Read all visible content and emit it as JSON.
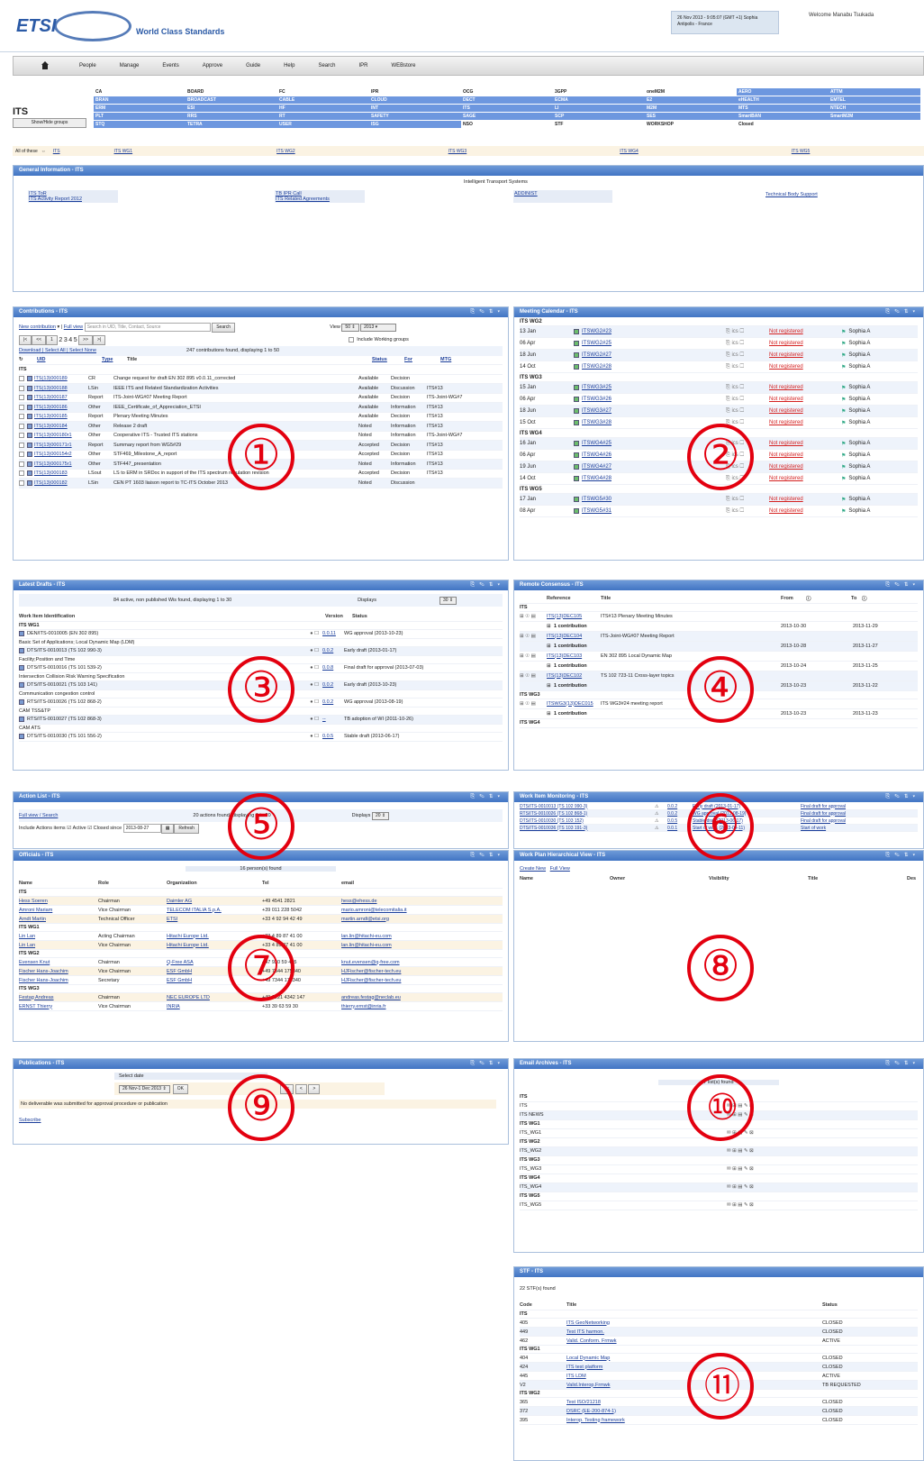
{
  "header": {
    "logo_text": "ETSI",
    "tagline": "World Class Standards",
    "user_info": "26 Nov 2013 - 9:05:07 (GMT +1) Sophia Antipolis - France",
    "welcome": "Welcome Manabu Tsukada"
  },
  "nav": [
    "People",
    "Manage",
    "Events",
    "Approve",
    "Guide",
    "Help",
    "Search",
    "IPR",
    "WEBstore"
  ],
  "groups": {
    "title": "ITS",
    "show_hide": "Show/Hide groups",
    "cells": [
      [
        "CA",
        "BOARD",
        "FC",
        "IPR",
        "OCG",
        "3GPP",
        "oneM2M",
        "AERO",
        "ATTM"
      ],
      [
        "BRAN",
        "BROADCAST",
        "CABLE",
        "CLOUD",
        "DECT",
        "ECMA",
        "E2",
        "eHEALTH",
        "EMTEL"
      ],
      [
        "ERM",
        "ESI",
        "HF",
        "INT",
        "ITS",
        "LI",
        "M2M",
        "MTS",
        "NTECH"
      ],
      [
        "PLT",
        "RRS",
        "RT",
        "SAFETY",
        "SAGE",
        "SCP",
        "SES",
        "SmartBAN",
        "SmartM2M"
      ],
      [
        "STQ",
        "TETRA",
        "USER",
        "ISG",
        "NSO",
        "STF",
        "WORKSHOP",
        "Closed",
        ""
      ]
    ],
    "highlighted": [
      [
        0,
        7
      ],
      [
        0,
        8
      ],
      [
        1,
        0
      ],
      [
        1,
        1
      ],
      [
        1,
        2
      ],
      [
        1,
        3
      ],
      [
        1,
        4
      ],
      [
        1,
        5
      ],
      [
        1,
        6
      ],
      [
        1,
        7
      ],
      [
        1,
        8
      ],
      [
        2,
        0
      ],
      [
        2,
        1
      ],
      [
        2,
        2
      ],
      [
        2,
        3
      ],
      [
        2,
        4
      ],
      [
        2,
        5
      ],
      [
        2,
        6
      ],
      [
        2,
        7
      ],
      [
        2,
        8
      ],
      [
        3,
        0
      ],
      [
        3,
        1
      ],
      [
        3,
        2
      ],
      [
        3,
        3
      ],
      [
        3,
        4
      ],
      [
        3,
        5
      ],
      [
        3,
        6
      ],
      [
        3,
        7
      ],
      [
        3,
        8
      ],
      [
        4,
        0
      ],
      [
        4,
        1
      ],
      [
        4,
        2
      ],
      [
        4,
        3
      ]
    ],
    "all_of_these": "All of these",
    "wg_links": [
      "ITS",
      "ITS WG1",
      "ITS WG2",
      "ITS WG3",
      "ITS WG4",
      "ITS WG5"
    ]
  },
  "general_info": {
    "title": "General Information - ITS",
    "center_label": "Intelligent Transport Systems",
    "links": [
      "ITS ToR",
      "ITS Activity Report 2012",
      "TB IPR Call",
      "ITS Related Agreements",
      "ADDINIST",
      "Technical Body Support"
    ]
  },
  "contributions": {
    "title": "Contributions - ITS",
    "new_link": "New contribution",
    "full_view": "Full view",
    "search_placeholder": "Search in UID, Title, Contact, Source",
    "search_btn": "Search",
    "view_label": "View",
    "view_count": "50",
    "view_year": "2013",
    "pages": [
      "1",
      "2",
      "3",
      "4",
      "5"
    ],
    "include_wg": "Include Working groups",
    "download_links": "Download | Select All | Select None",
    "found": "247 contributions found, displaying 1 to 50",
    "col_uid": "UID",
    "col_type": "Type",
    "col_title": "Title",
    "col_status": "Status",
    "col_for": "For",
    "col_mtg": "MTG",
    "group": "ITS",
    "rows": [
      [
        "ITS(13)000189",
        "CR",
        "Change request for draft EN 302 895 v0.0.11_corrected",
        "Available",
        "Decision",
        ""
      ],
      [
        "ITS(13)000188",
        "LSin",
        "IEEE ITS and Related Standardization Activities",
        "Available",
        "Discussion",
        "ITS#13"
      ],
      [
        "ITS(13)000187",
        "Report",
        "ITS-Joint-WG#07 Meeting Report",
        "Available",
        "Decision",
        "ITS-Joint-WG#7"
      ],
      [
        "ITS(13)000186",
        "Other",
        "IEEE_Certificate_of_Appreciation_ETSI",
        "Available",
        "Information",
        "ITS#13"
      ],
      [
        "ITS(13)000185",
        "Report",
        "Plenary Meeting Minutes",
        "Available",
        "Decision",
        "ITS#13"
      ],
      [
        "ITS(13)000184",
        "Other",
        "Release 2 draft",
        "Noted",
        "Information",
        "ITS#13"
      ],
      [
        "ITS(13)000180r1",
        "Other",
        "Cooperative ITS - Trusted ITS stations",
        "Noted",
        "Information",
        "ITS-Joint-WG#7"
      ],
      [
        "ITS(13)000171r1",
        "Report",
        "Summary report from WG5#29",
        "Accepted",
        "Decision",
        "ITS#13"
      ],
      [
        "ITS(13)000154r2",
        "Other",
        "STF469_Milestone_A_report",
        "Accepted",
        "Decision",
        "ITS#13"
      ],
      [
        "ITS(13)000175r1",
        "Other",
        "STF447_presentation",
        "Noted",
        "Information",
        "ITS#13"
      ],
      [
        "ITS(13)000183",
        "LSout",
        "LS to ERM in SRDoc in support of the ITS spectrum regulation revision",
        "Accepted",
        "Decision",
        "ITS#13"
      ],
      [
        "ITS(13)000182",
        "LSin",
        "CEN PT 1603 liaison report to TC-ITS October 2013",
        "Noted",
        "Discussion",
        ""
      ]
    ]
  },
  "meeting_calendar": {
    "title": "Meeting Calendar - ITS",
    "groups": [
      {
        "name": "ITS WG2",
        "rows": [
          [
            "13 Jan",
            "ITSWG2#23"
          ],
          [
            "06 Apr",
            "ITSWG2#25"
          ],
          [
            "18 Jun",
            "ITSWG2#27"
          ],
          [
            "14 Oct",
            "ITSWG2#28"
          ]
        ]
      },
      {
        "name": "ITS WG3",
        "rows": [
          [
            "15 Jan",
            "ITSWG3#25"
          ],
          [
            "06 Apr",
            "ITSWG3#26"
          ],
          [
            "18 Jun",
            "ITSWG3#27"
          ],
          [
            "15 Oct",
            "ITSWG3#28"
          ]
        ]
      },
      {
        "name": "ITS WG4",
        "rows": [
          [
            "16 Jan",
            "ITSWG4#25"
          ],
          [
            "06 Apr",
            "ITSWG4#26"
          ],
          [
            "19 Jun",
            "ITSWG4#27"
          ],
          [
            "14 Oct",
            "ITSWG4#28"
          ]
        ]
      },
      {
        "name": "ITS WG5",
        "rows": [
          [
            "17 Jan",
            "ITSWG5#30"
          ],
          [
            "08 Apr",
            "ITSWG5#31"
          ]
        ]
      }
    ],
    "reg_status": "Not registered",
    "location": "Sophia A"
  },
  "latest_drafts": {
    "title": "Latest Drafts - ITS",
    "found": "84 active, non published Wis found, displaying 1 to 30",
    "displays": "Displays",
    "count": "30",
    "col_wi": "Work Item Identification",
    "col_version": "Version",
    "col_status": "Status",
    "rows": [
      {
        "group": "ITS WG1",
        "id": "DEN/ITS-0010005 (EN 302 895)",
        "desc": "Basic Set of Applications; Local Dynamic Map (LDM)",
        "ver": "0.0.11",
        "status": "WG approval (2013-10-23)"
      },
      {
        "id": "DTS/ITS-0010013 (TS 102 990-3)",
        "desc": "Facility;Position and Time",
        "ver": "0.0.2",
        "status": "Early draft (2013-01-17)"
      },
      {
        "id": "DTS/ITS-0010016 (TS 101 539-2)",
        "desc": "Intersection Collision Risk Warning Specification",
        "ver": "0.0.8",
        "status": "Final draft for approval (2013-07-03)"
      },
      {
        "id": "DTS/ITS-0010021 (TS 103 141)",
        "desc": "Communication congestion control",
        "ver": "0.0.2",
        "status": "Early draft (2013-10-23)"
      },
      {
        "id": "RTS/ITS-0010026 (TS 102 868-2)",
        "desc": "CAM TSS&TP",
        "ver": "0.0.2",
        "status": "WG approval (2013-08-19)"
      },
      {
        "id": "RTS/ITS-0010027 (TS 102 868-3)",
        "desc": "CAM ATS",
        "ver": "--",
        "status": "TB adoption of WI (2011-10-26)"
      },
      {
        "id": "DTS/ITS-0010030 (TS 101 556-2)",
        "desc": "",
        "ver": "0.0.5",
        "status": "Stable draft (2013-06-17)"
      }
    ]
  },
  "remote_consensus": {
    "title": "Remote Consensus - ITS",
    "col_ref": "Reference",
    "col_title": "Title",
    "col_from": "From",
    "col_to": "To",
    "contribution": "1 contribution",
    "rows": [
      {
        "group": "ITS",
        "ref": "ITS(13)DEC105",
        "title": "ITS#13 Plenary Meeting Minutes",
        "from": "2013-10-30",
        "to": "2013-11-29"
      },
      {
        "ref": "ITS(13)DEC104",
        "title": "ITS-Joint-WG#07 Meeting Report",
        "from": "2013-10-28",
        "to": "2013-11-27"
      },
      {
        "ref": "ITS(13)DEC103",
        "title": "EN 302 895 Local Dynamic Map",
        "from": "2013-10-24",
        "to": "2013-11-25"
      },
      {
        "ref": "ITS(13)DEC102",
        "title": "TS 102 723-11 Cross-layer topics",
        "from": "2013-10-23",
        "to": "2013-11-22"
      },
      {
        "group": "ITS WG3",
        "ref": "ITSWG3(13)DEC015",
        "title": "ITS WG3#24 meeting report",
        "from": "2013-10-23",
        "to": "2013-11-23"
      }
    ],
    "last_group": "ITS WG4"
  },
  "action_list": {
    "title": "Action List - ITS",
    "full_view": "Full view / Search",
    "found": "20 actions found, displaying 1 to 20",
    "displays": "Displays",
    "count": "20",
    "include": "Include Actions items",
    "active": "Active",
    "closed": "Closed since",
    "date": "2013-08-27",
    "refresh": "Refresh"
  },
  "work_item_monitoring": {
    "title": "Work Item Monitoring - ITS",
    "rows": [
      [
        "DTS/ITS-0010013 (TS 102 990-3)",
        "0.0.2",
        "Early draft (2013-01-17)",
        "Final draft for approval"
      ],
      [
        "RTS/ITS-0010026 (TS 102 868-1)",
        "0.0.2",
        "WG approval (2013-08-19)",
        "Final draft for approval"
      ],
      [
        "DTS/ITS-0010030 (TS 103 152)",
        "0.0.5",
        "Stable draft (2013-06-17)",
        "Final draft for approval"
      ],
      [
        "DTS/ITS-0010036 (TS 103 191-3)",
        "0.0.1",
        "Start of work (2013-04-11)",
        "Start of work"
      ]
    ]
  },
  "officials": {
    "title": "Officials - ITS",
    "found": "16 person(s) found",
    "cols": [
      "Name",
      "Role",
      "Organization",
      "Tel",
      "email"
    ],
    "groups": [
      {
        "name": "ITS",
        "rows": [
          [
            "Hess Soeren",
            "Chairman",
            "Daimler AG",
            "+49 4541 2821",
            "hess@ehess.de"
          ],
          [
            "Amroni Mariam",
            "Vice Chairman",
            "TELECOM ITALIA S.p.A.",
            "+39 011 228 5042",
            "mario.amroni@telecomitalia.it"
          ],
          [
            "Arndt Martin",
            "Technical Officer",
            "ETSI",
            "+33 4 92 94 42 49",
            "martin.arndt@etsi.org"
          ]
        ]
      },
      {
        "name": "ITS WG1",
        "rows": [
          [
            "Lin Lan",
            "Acting Chairman",
            "Hitachi Europe Ltd.",
            "+33 4 89 87 41 00",
            "lan.lin@hitachi-eu.com"
          ],
          [
            "Lin Lan",
            "Vice Chairman",
            "Hitachi Europe Ltd.",
            "+33 4 89 87 41 00",
            "lan.lin@hitachi-eu.com"
          ]
        ]
      },
      {
        "name": "ITS WG2",
        "rows": [
          [
            "Evensen Knut",
            "Chairman",
            "Q-Free ASA",
            "+47 920 59 405",
            "knut.evensen@q-free.com"
          ],
          [
            "Fischer Hans-Joachim",
            "Vice Chairman",
            "ESF GmbH",
            "+49 7344 175340",
            "HJFischer@fischer-tech.eu"
          ],
          [
            "Fischer Hans-Joachim",
            "Secretary",
            "ESF GmbH",
            "+49 7344 175340",
            "HJFischer@fischer-tech.eu"
          ]
        ]
      },
      {
        "name": "ITS WG3",
        "rows": [
          [
            "Festag Andreas",
            "Chairman",
            "NEC EUROPE LTD",
            "+49 6221 4342 147",
            "andreas.festag@neclab.eu"
          ],
          [
            "ERNST Thierry",
            "Vice Chairman",
            "INRIA",
            "+33 39 63 59 30",
            "thierry.ernst@inria.fr"
          ]
        ]
      }
    ]
  },
  "work_plan": {
    "title": "Work Plan Hierarchical View - ITS",
    "create_new": "Create New",
    "full_view": "Full View",
    "cols": [
      "Name",
      "Owner",
      "Visibility",
      "Title",
      "Des"
    ]
  },
  "publications": {
    "title": "Publications - ITS",
    "select_date": "Select date",
    "date_value": "26 Nov-1 Dec 2013",
    "ok": "OK",
    "nav": [
      "<<",
      "<",
      ">"
    ],
    "message": "No deliverable was submitted for approval procedure or publication",
    "subscribe": "Subscribe"
  },
  "email_archives": {
    "title": "Email Archives - ITS",
    "found": "7 list(s) found",
    "rows": [
      {
        "group": "ITS",
        "name": "ITS"
      },
      {
        "name": "ITS NEWS"
      },
      {
        "group": "ITS WG1",
        "name": "ITS_WG1"
      },
      {
        "group": "ITS WG2",
        "name": "ITS_WG2"
      },
      {
        "group": "ITS WG3",
        "name": "ITS_WG3"
      },
      {
        "group": "ITS WG4",
        "name": "ITS_WG4"
      },
      {
        "group": "ITS WG5",
        "name": "ITS_WG5"
      }
    ]
  },
  "stf": {
    "title": "STF - ITS",
    "found": "22 STF(s) found",
    "cols": [
      "Code",
      "Title",
      "Status"
    ],
    "groups": [
      {
        "name": "ITS",
        "rows": [
          [
            "405",
            "ITS GeoNetworking",
            "CLOSED"
          ],
          [
            "449",
            "Test ITS harmon.",
            "CLOSED"
          ],
          [
            "462",
            "Valid. Conform. Frmwk",
            "ACTIVE"
          ]
        ]
      },
      {
        "name": "ITS WG1",
        "rows": [
          [
            "404",
            "Local Dynamic Map",
            "CLOSED"
          ],
          [
            "424",
            "ITS test platform",
            "CLOSED"
          ],
          [
            "445",
            "ITS LDM",
            "ACTIVE"
          ],
          [
            "V2",
            "Valid.Interop.Frmwk",
            "TB REQUESTED"
          ]
        ]
      },
      {
        "name": "ITS WG2",
        "rows": [
          [
            "365",
            "Test ISO/21218",
            "CLOSED"
          ],
          [
            "372",
            "DSRC (EE-200-874-1)",
            "CLOSED"
          ],
          [
            "395",
            "Interop. Testing framework",
            "CLOSED"
          ]
        ]
      }
    ]
  },
  "markers": [
    "①",
    "②",
    "③",
    "④",
    "⑤",
    "⑥",
    "⑦",
    "⑧",
    "⑨",
    "⑩",
    "⑪"
  ],
  "colors": {
    "panel_header": "#4174c3",
    "highlight": "#6d97df",
    "marker": "#e3000f"
  }
}
